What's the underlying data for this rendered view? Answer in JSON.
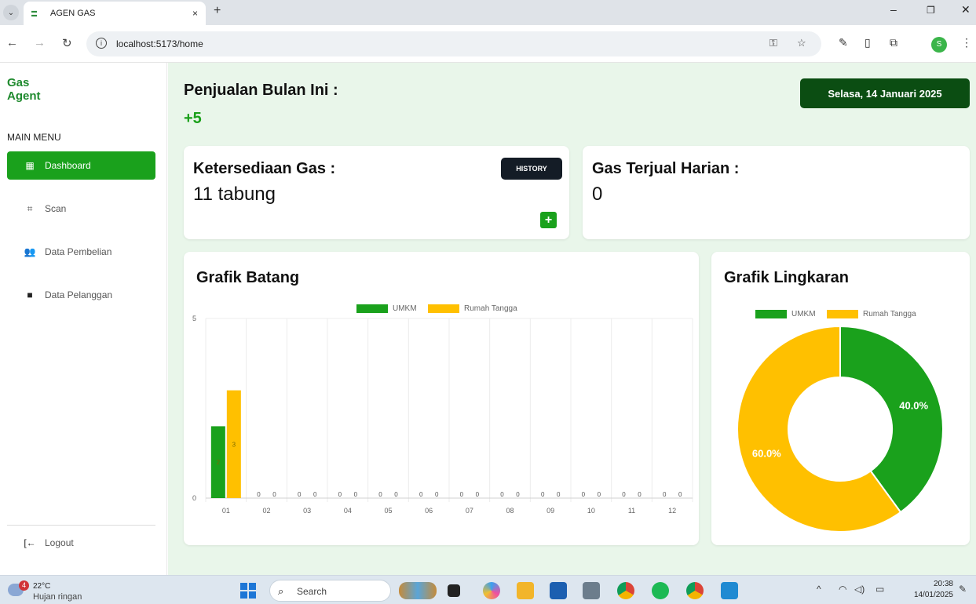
{
  "browser": {
    "tab_title": "AGEN GAS",
    "tab_close": "×",
    "new_tab": "+",
    "url": "localhost:5173/home"
  },
  "sidebar": {
    "brand_line1": "Gas",
    "brand_line2": "Agent",
    "menu_title": "MAIN MENU",
    "items": [
      {
        "label": "Dashboard",
        "icon": "grid-icon"
      },
      {
        "label": "Scan",
        "icon": "scan-icon"
      },
      {
        "label": "Data Pembelian",
        "icon": "users-icon"
      },
      {
        "label": "Data Pelanggan",
        "icon": "contact-icon"
      }
    ],
    "logout": "Logout"
  },
  "header": {
    "title": "Penjualan Bulan Ini :",
    "value": "+5",
    "date": "Selasa, 14 Januari 2025"
  },
  "cards": {
    "stock": {
      "title": "Ketersediaan Gas :",
      "value": "11 tabung",
      "history": "HISTORY",
      "add": "+"
    },
    "daily": {
      "title": "Gas Terjual Harian :",
      "value": "0"
    }
  },
  "bar_card": {
    "title": "Grafik Batang"
  },
  "pie_card": {
    "title": "Grafik Lingkaran"
  },
  "chart_data": [
    {
      "type": "bar",
      "categories": [
        "01",
        "02",
        "03",
        "04",
        "05",
        "06",
        "07",
        "08",
        "09",
        "10",
        "11",
        "12"
      ],
      "series": [
        {
          "name": "UMKM",
          "values": [
            2,
            0,
            0,
            0,
            0,
            0,
            0,
            0,
            0,
            0,
            0,
            0
          ],
          "color": "#1aa11c"
        },
        {
          "name": "Rumah Tangga",
          "values": [
            3,
            0,
            0,
            0,
            0,
            0,
            0,
            0,
            0,
            0,
            0,
            0
          ],
          "color": "#ffc000"
        }
      ],
      "ylim": [
        0,
        5
      ],
      "yticks": [
        0,
        5
      ],
      "legend": "top",
      "grid": true
    },
    {
      "type": "pie",
      "donut": true,
      "labels": [
        "UMKM",
        "Rumah Tangga"
      ],
      "values": [
        40.0,
        60.0
      ],
      "data_labels": [
        "40.0%",
        "60.0%"
      ],
      "colors": [
        "#1aa11c",
        "#ffc000"
      ],
      "legend": "top"
    }
  ],
  "taskbar": {
    "temp": "22°C",
    "weather": "Hujan ringan",
    "badge": "4",
    "search": "Search",
    "time": "20:38",
    "date": "14/01/2025"
  }
}
